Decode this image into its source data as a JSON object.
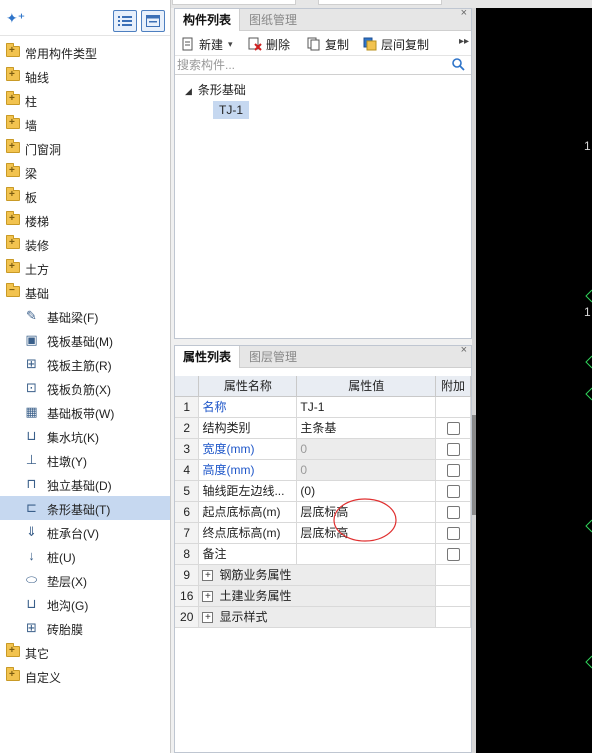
{
  "left_panel": {
    "tree": [
      {
        "label": "常用构件类型",
        "sign": "+"
      },
      {
        "label": "轴线",
        "sign": "+"
      },
      {
        "label": "柱",
        "sign": "+"
      },
      {
        "label": "墙",
        "sign": "+"
      },
      {
        "label": "门窗洞",
        "sign": "+"
      },
      {
        "label": "梁",
        "sign": "+"
      },
      {
        "label": "板",
        "sign": "+"
      },
      {
        "label": "楼梯",
        "sign": "+"
      },
      {
        "label": "装修",
        "sign": "+"
      },
      {
        "label": "土方",
        "sign": "+"
      },
      {
        "label": "基础",
        "sign": "−"
      }
    ],
    "foundation_children": [
      {
        "label": "基础梁(F)",
        "icon": "pencil-icon",
        "glyph": "✎"
      },
      {
        "label": "筏板基础(M)",
        "icon": "raft-slab-icon",
        "glyph": "▣"
      },
      {
        "label": "筏板主筋(R)",
        "icon": "main-rebar-icon",
        "glyph": "⊞"
      },
      {
        "label": "筏板负筋(X)",
        "icon": "negative-rebar-icon",
        "glyph": "⊡"
      },
      {
        "label": "基础板带(W)",
        "icon": "slab-strip-icon",
        "glyph": "▦"
      },
      {
        "label": "集水坑(K)",
        "icon": "sump-pit-icon",
        "glyph": "⊔"
      },
      {
        "label": "柱墩(Y)",
        "icon": "column-pier-icon",
        "glyph": "⊥"
      },
      {
        "label": "独立基础(D)",
        "icon": "isolated-foundation-icon",
        "glyph": "⊓"
      },
      {
        "label": "条形基础(T)",
        "icon": "strip-foundation-icon",
        "glyph": "⊏"
      },
      {
        "label": "桩承台(V)",
        "icon": "pile-cap-icon",
        "glyph": "⇓"
      },
      {
        "label": "桩(U)",
        "icon": "pile-icon",
        "glyph": "↓"
      },
      {
        "label": "垫层(X)",
        "icon": "cushion-icon",
        "glyph": "⬭"
      },
      {
        "label": "地沟(G)",
        "icon": "trench-icon",
        "glyph": "⊔"
      },
      {
        "label": "砖胎膜",
        "icon": "brick-mold-icon",
        "glyph": "⊞"
      }
    ],
    "tree_after": [
      {
        "label": "其它",
        "sign": "+"
      },
      {
        "label": "自定义",
        "sign": "+"
      }
    ],
    "selected_child_index": 8
  },
  "component_panel": {
    "tabs": {
      "active": "构件列表",
      "inactive": "图纸管理"
    },
    "toolbar": {
      "new": "新建",
      "delete": "删除",
      "copy": "复制",
      "floor_copy": "层间复制"
    },
    "search": {
      "placeholder": "搜索构件...",
      "value": ""
    },
    "tree": {
      "group": "条形基础",
      "item": "TJ-1"
    }
  },
  "property_panel": {
    "tabs": {
      "active": "属性列表",
      "inactive": "图层管理"
    },
    "headers": {
      "name": "属性名称",
      "value": "属性值",
      "extra": "附加"
    },
    "rows": [
      {
        "num": "1",
        "name": "名称",
        "value": "TJ-1",
        "name_blue": true,
        "value_gray": false,
        "check": false
      },
      {
        "num": "2",
        "name": "结构类别",
        "value": "主条基",
        "name_blue": false,
        "value_gray": false,
        "check": true
      },
      {
        "num": "3",
        "name": "宽度(mm)",
        "value": "0",
        "name_blue": true,
        "value_gray": true,
        "check": true
      },
      {
        "num": "4",
        "name": "高度(mm)",
        "value": "0",
        "name_blue": true,
        "value_gray": true,
        "check": true
      },
      {
        "num": "5",
        "name": "轴线距左边线...",
        "value": "(0)",
        "name_blue": false,
        "value_gray": false,
        "check": true
      },
      {
        "num": "6",
        "name": "起点底标高(m)",
        "value": "层底标高",
        "name_blue": false,
        "value_gray": false,
        "check": true
      },
      {
        "num": "7",
        "name": "终点底标高(m)",
        "value": "层底标高",
        "name_blue": false,
        "value_gray": false,
        "check": true
      },
      {
        "num": "8",
        "name": "备注",
        "value": "",
        "name_blue": false,
        "value_gray": false,
        "check": true
      }
    ],
    "groups": [
      {
        "num": "9",
        "name": "钢筋业务属性"
      },
      {
        "num": "16",
        "name": "土建业务属性"
      },
      {
        "num": "20",
        "name": "显示样式"
      }
    ]
  },
  "colors": {
    "selected_row": "#c6d8f0",
    "accent_blue": "#1f57c9",
    "annotation_red": "#e03030",
    "canvas": "#000000",
    "canvas_marks": "#2fd35a"
  }
}
